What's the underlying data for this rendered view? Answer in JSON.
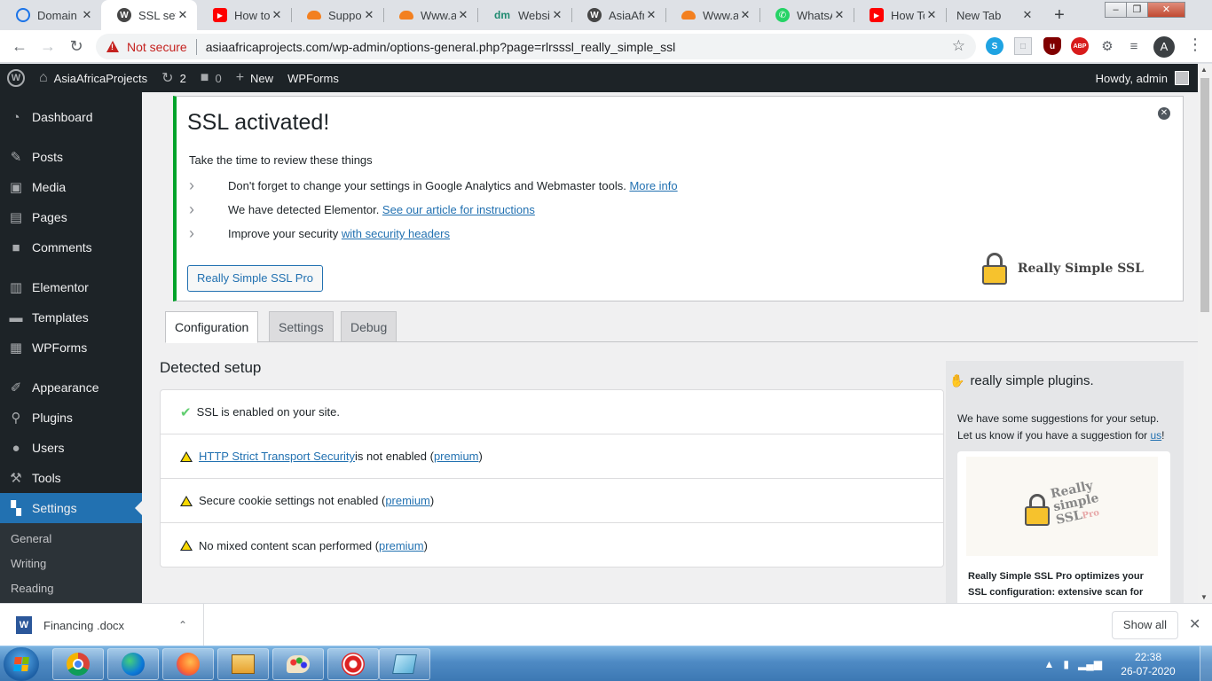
{
  "browser": {
    "tabs": [
      {
        "label": "Domain",
        "favicon": "wifi-logo-icon",
        "color": "#1a73e8",
        "active": false
      },
      {
        "label": "SSL sett",
        "favicon": "wordpress-icon",
        "color": "#464646",
        "active": true
      },
      {
        "label": "How to",
        "favicon": "youtube-icon",
        "color": "#ff0000",
        "active": false
      },
      {
        "label": "Support",
        "favicon": "cloudflare-icon",
        "color": "#f38020",
        "active": false
      },
      {
        "label": "Www.as",
        "favicon": "cloudflare-icon",
        "color": "#f38020",
        "active": false
      },
      {
        "label": "Website",
        "favicon": "dm-icon",
        "color": "#1f8a70",
        "active": false
      },
      {
        "label": "AsiaAfri",
        "favicon": "wordpress-icon",
        "color": "#464646",
        "active": false
      },
      {
        "label": "Www.as",
        "favicon": "cloudflare-icon",
        "color": "#f38020",
        "active": false
      },
      {
        "label": "WhatsA",
        "favicon": "whatsapp-icon",
        "color": "#25d366",
        "active": false
      },
      {
        "label": "How To",
        "favicon": "youtube-icon",
        "color": "#ff0000",
        "active": false
      },
      {
        "label": "New Tab",
        "favicon": "",
        "color": "",
        "active": false
      }
    ],
    "security_label": "Not secure",
    "url": "asiaafricaprojects.com/wp-admin/options-general.php?page=rlrsssl_really_simple_ssl",
    "profile_initial": "A"
  },
  "adminbar": {
    "site_name": "AsiaAfricaProjects",
    "updates_count": "2",
    "comments_count": "0",
    "new_label": "New",
    "wpforms_label": "WPForms",
    "howdy": "Howdy, admin"
  },
  "sidebar": {
    "items": [
      {
        "label": "Dashboard",
        "icon": "dashboard-icon",
        "current": false
      },
      {
        "label": "Posts",
        "icon": "pin-icon",
        "current": false
      },
      {
        "label": "Media",
        "icon": "media-icon",
        "current": false
      },
      {
        "label": "Pages",
        "icon": "pages-icon",
        "current": false
      },
      {
        "label": "Comments",
        "icon": "comment-icon",
        "current": false
      },
      {
        "label": "Elementor",
        "icon": "elementor-icon",
        "current": false
      },
      {
        "label": "Templates",
        "icon": "folder-icon",
        "current": false
      },
      {
        "label": "WPForms",
        "icon": "form-icon",
        "current": false
      },
      {
        "label": "Appearance",
        "icon": "brush-icon",
        "current": false
      },
      {
        "label": "Plugins",
        "icon": "plugin-icon",
        "current": false
      },
      {
        "label": "Users",
        "icon": "user-icon",
        "current": false
      },
      {
        "label": "Tools",
        "icon": "wrench-icon",
        "current": false
      },
      {
        "label": "Settings",
        "icon": "settings-icon",
        "current": true
      }
    ],
    "submenu": [
      "General",
      "Writing",
      "Reading"
    ]
  },
  "notice": {
    "title": "SSL activated!",
    "subtitle": "Take the time to review these things",
    "items": [
      {
        "text": "Don't forget to change your settings in Google Analytics and Webmaster tools. ",
        "link": "More info",
        "after": ""
      },
      {
        "text": "We have detected Elementor. ",
        "link": "See our article for instructions",
        "after": ""
      },
      {
        "text": "Improve your security ",
        "link": "with security headers",
        "after": ""
      }
    ],
    "pro_button": "Really Simple SSL Pro",
    "brand": "Really Simple SSL"
  },
  "tabs": [
    "Configuration",
    "Settings",
    "Debug"
  ],
  "setup": {
    "title": "Detected setup",
    "rows": [
      {
        "status": "ok",
        "pre": "",
        "link": "",
        "text": "SSL is enabled on your site.",
        "premium": ""
      },
      {
        "status": "warn",
        "pre": "",
        "link": "HTTP Strict Transport Security",
        "text": " is not enabled (",
        "premium": "premium"
      },
      {
        "status": "warn",
        "pre": "",
        "link": "",
        "text": "Secure cookie settings not enabled (",
        "premium": "premium"
      },
      {
        "status": "warn",
        "pre": "",
        "link": "",
        "text": "No mixed content scan performed (",
        "premium": "premium"
      }
    ]
  },
  "panel": {
    "heading": "really simple plugins.",
    "text_line1": "We have some suggestions for your setup.",
    "text_line2": "Let us know if you have a suggestion for ",
    "text_link": "us",
    "logo_text": [
      "Really",
      "simple",
      "SSL"
    ],
    "logo_pro": "Pro",
    "card_text": "Really Simple SSL Pro optimizes your SSL configuration: extensive scan for mixed"
  },
  "download": {
    "filename": "Financing .docx",
    "show_all": "Show all"
  },
  "taskbar": {
    "time": "22:38",
    "date": "26-07-2020"
  }
}
